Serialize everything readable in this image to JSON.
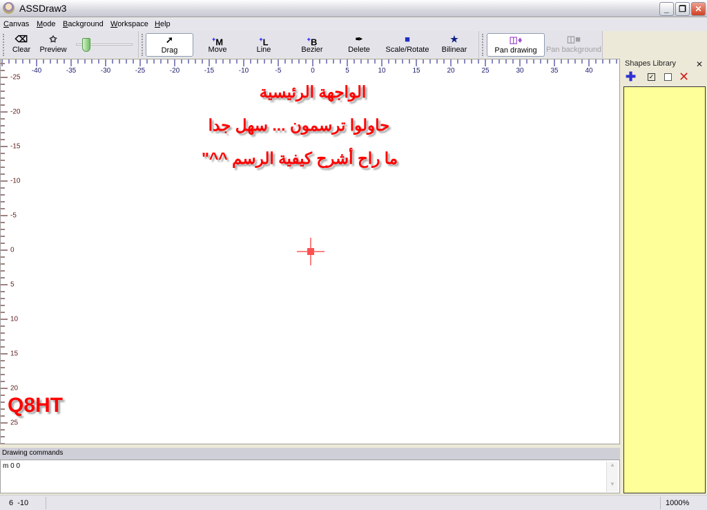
{
  "window": {
    "title": "ASSDraw3",
    "minimize": "_",
    "restore": "❐",
    "close": "✕"
  },
  "menu": [
    {
      "label": "Canvas",
      "u": "C",
      "rest": "anvas"
    },
    {
      "label": "Mode",
      "u": "M",
      "rest": "ode"
    },
    {
      "label": "Background",
      "u": "B",
      "rest": "ackground"
    },
    {
      "label": "Workspace",
      "u": "W",
      "rest": "orkspace"
    },
    {
      "label": "Help",
      "u": "H",
      "rest": "elp"
    }
  ],
  "toolbar": {
    "clear": "Clear",
    "preview": "Preview",
    "slider_value": 0.2,
    "drag": "Drag",
    "move": "Move",
    "line": "Line",
    "bezier": "Bezier",
    "delete": "Delete",
    "scale_rotate": "Scale/Rotate",
    "bilinear": "Bilinear",
    "pan_drawing": "Pan drawing",
    "pan_background": "Pan background",
    "icons": {
      "move": "M",
      "line": "L",
      "bezier": "B"
    }
  },
  "rulers": {
    "horizontal": [
      "-40",
      "-35",
      "-30",
      "-25",
      "-20",
      "-15",
      "-10",
      "-5",
      "0",
      "5",
      "10",
      "15",
      "20",
      "25",
      "30",
      "35",
      "40"
    ],
    "vertical": [
      "-25",
      "-20",
      "-15",
      "-10",
      "-5",
      "0",
      "5",
      "10",
      "15",
      "20",
      "25"
    ]
  },
  "canvas": {
    "text_lines": [
      "الواجهة الرئيسية",
      "حاولوا ترسمون ... سهل جدا",
      "ما راح أشرح كيفية الرسم ^^\""
    ],
    "logo": "Q8HT",
    "text_color": "#ff0000"
  },
  "shapes_library": {
    "title": "Shapes Library",
    "close": "✕",
    "background": "#ffff99"
  },
  "drawing_commands": {
    "label": "Drawing commands",
    "value": "m 0 0"
  },
  "status": {
    "coords": "6  -10",
    "zoom": "1000%"
  }
}
